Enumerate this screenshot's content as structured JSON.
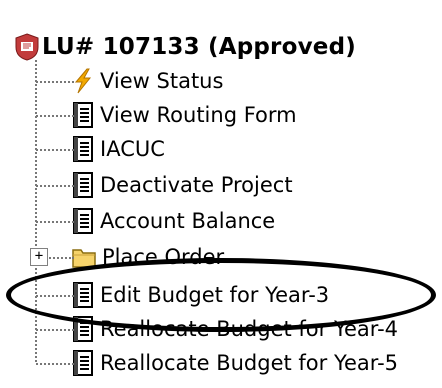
{
  "root": {
    "label": "LU# 107133 (Approved)",
    "icon": "seal-icon"
  },
  "items": [
    {
      "label": "View Status",
      "icon": "lightning-icon"
    },
    {
      "label": "View Routing Form",
      "icon": "document-icon"
    },
    {
      "label": "IACUC",
      "icon": "document-icon"
    },
    {
      "label": "Deactivate Project",
      "icon": "document-icon"
    },
    {
      "label": "Account Balance",
      "icon": "document-icon"
    },
    {
      "label": "Place Order",
      "icon": "folder-icon",
      "expandable": true,
      "expander": "+"
    },
    {
      "label": "Edit Budget for Year-3",
      "icon": "document-icon",
      "highlighted": true
    },
    {
      "label": "Reallocate Budget for Year-4",
      "icon": "document-icon"
    },
    {
      "label": "Reallocate Budget for Year-5",
      "icon": "document-icon"
    }
  ],
  "colors": {
    "lightning": "#f2a900",
    "folder": "#f6d36a",
    "seal": "#c23b3b"
  }
}
